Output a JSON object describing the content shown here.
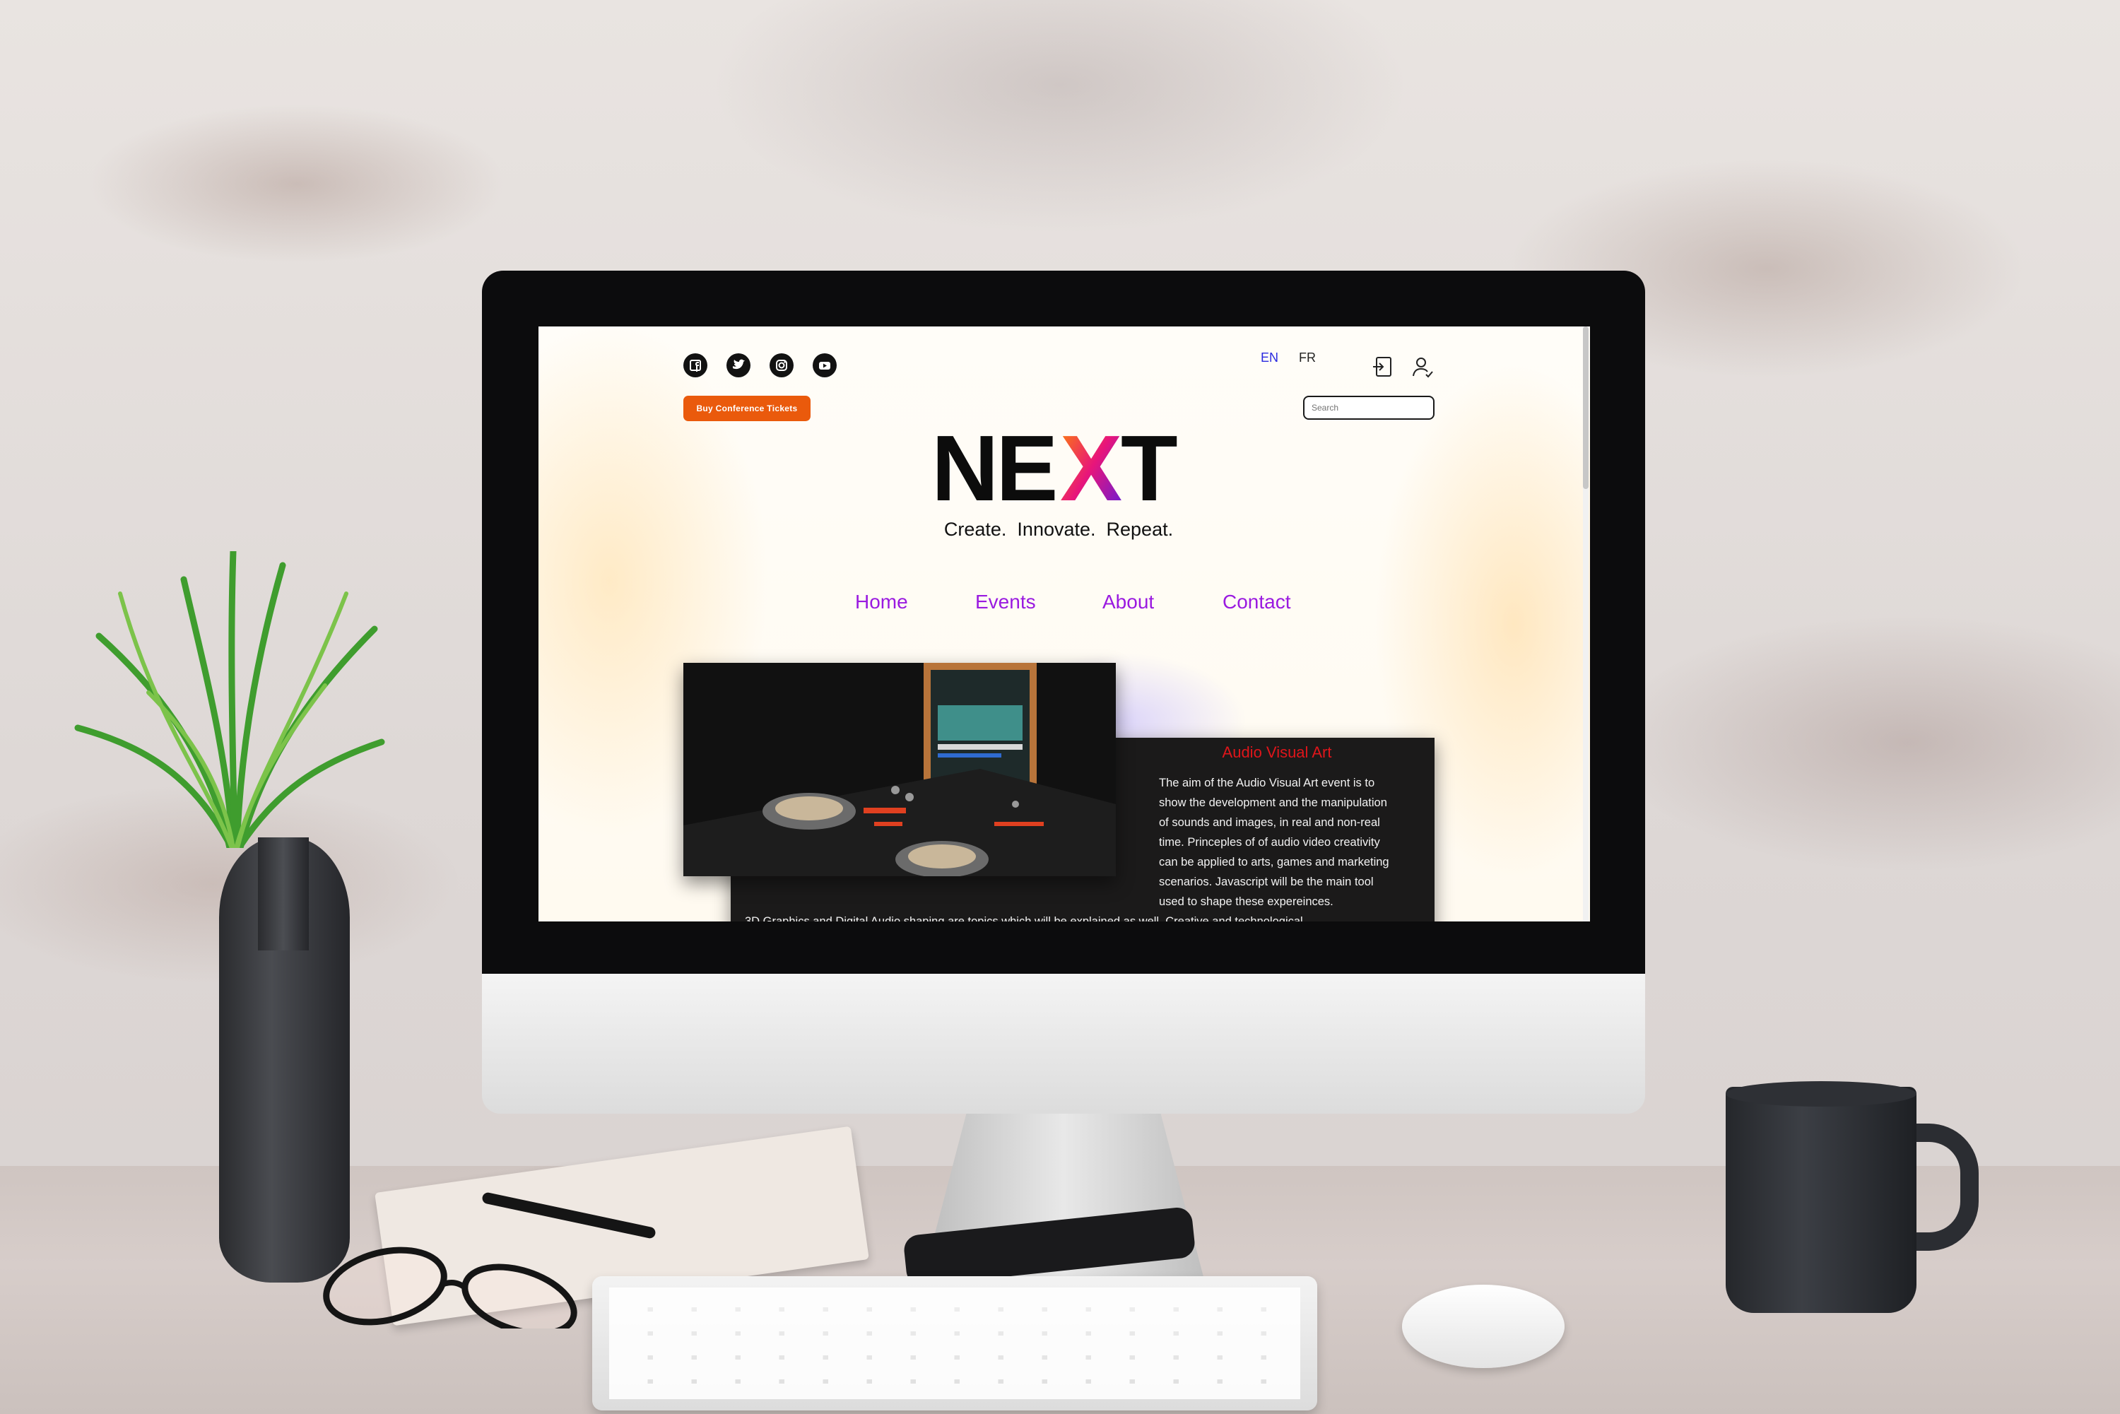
{
  "header": {
    "social_icons": [
      "facebook-icon",
      "twitter-icon",
      "instagram-icon",
      "youtube-icon"
    ],
    "languages": [
      "EN",
      "FR"
    ],
    "active_language": "EN",
    "buy_button_label": "Buy Conference Tickets",
    "search_placeholder": "Search"
  },
  "brand": {
    "logo_text": "NEXT",
    "tagline": "Create.  Innovate.  Repeat."
  },
  "nav": {
    "items": [
      "Home",
      "Events",
      "About",
      "Contact"
    ]
  },
  "feature_card": {
    "title": "Audio Visual Art",
    "body_lines": [
      "The aim of the Audio Visual Art event is to",
      "show the development and the manipulation",
      "of sounds and images, in real and non-real",
      "time. Princeples of of audio video creativity",
      "can be applied to arts, games and marketing",
      "scenarios. Javascript will be the main tool",
      "used to shape these expereinces."
    ],
    "body_continued": "3D Graphics and Digital Audio shaping are topics which will be explained as well. Creative and technological"
  },
  "colors": {
    "accent_orange": "#ea5a0c",
    "nav_purple": "#9a1ae0",
    "card_title_red": "#e0151a",
    "card_bg": "#1b1a1a",
    "active_language_blue": "#2a2ae0"
  }
}
